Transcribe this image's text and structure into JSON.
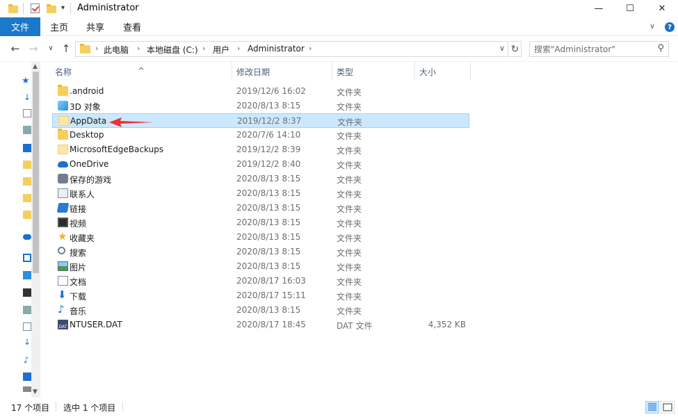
{
  "window": {
    "title": "Administrator",
    "minimize": "—",
    "maximize": "☐",
    "close": "✕"
  },
  "ribbon": {
    "tabs": [
      "文件",
      "主页",
      "共享",
      "查看"
    ],
    "expand": "∨",
    "help": "?"
  },
  "address": {
    "crumbs": [
      "此电脑",
      "本地磁盘 (C:)",
      "用户",
      "Administrator"
    ],
    "separator": "›"
  },
  "search": {
    "placeholder": "搜索\"Administrator\""
  },
  "columns": {
    "name": "名称",
    "date": "修改日期",
    "type": "类型",
    "size": "大小"
  },
  "files": [
    {
      "name": ".android",
      "date": "2019/12/6 16:02",
      "type": "文件夹",
      "size": "",
      "icon": "folder-icon"
    },
    {
      "name": "3D 对象",
      "date": "2020/8/13 8:15",
      "type": "文件夹",
      "size": "",
      "icon": "3d-objects-icon"
    },
    {
      "name": "AppData",
      "date": "2019/12/2 8:37",
      "type": "文件夹",
      "size": "",
      "icon": "hidden-folder-icon",
      "selected": true
    },
    {
      "name": "Desktop",
      "date": "2020/7/6 14:10",
      "type": "文件夹",
      "size": "",
      "icon": "folder-icon"
    },
    {
      "name": "MicrosoftEdgeBackups",
      "date": "2019/12/2 8:39",
      "type": "文件夹",
      "size": "",
      "icon": "hidden-folder-icon"
    },
    {
      "name": "OneDrive",
      "date": "2019/12/2 8:40",
      "type": "文件夹",
      "size": "",
      "icon": "onedrive-icon"
    },
    {
      "name": "保存的游戏",
      "date": "2020/8/13 8:15",
      "type": "文件夹",
      "size": "",
      "icon": "saved-games-icon"
    },
    {
      "name": "联系人",
      "date": "2020/8/13 8:15",
      "type": "文件夹",
      "size": "",
      "icon": "contacts-icon"
    },
    {
      "name": "链接",
      "date": "2020/8/13 8:15",
      "type": "文件夹",
      "size": "",
      "icon": "links-icon"
    },
    {
      "name": "视频",
      "date": "2020/8/13 8:15",
      "type": "文件夹",
      "size": "",
      "icon": "videos-icon"
    },
    {
      "name": "收藏夹",
      "date": "2020/8/13 8:15",
      "type": "文件夹",
      "size": "",
      "icon": "favorites-icon"
    },
    {
      "name": "搜索",
      "date": "2020/8/13 8:15",
      "type": "文件夹",
      "size": "",
      "icon": "searches-icon"
    },
    {
      "name": "图片",
      "date": "2020/8/13 8:15",
      "type": "文件夹",
      "size": "",
      "icon": "pictures-icon"
    },
    {
      "name": "文档",
      "date": "2020/8/17 16:03",
      "type": "文件夹",
      "size": "",
      "icon": "documents-icon"
    },
    {
      "name": "下载",
      "date": "2020/8/17 15:11",
      "type": "文件夹",
      "size": "",
      "icon": "downloads-icon"
    },
    {
      "name": "音乐",
      "date": "2020/8/13 8:15",
      "type": "文件夹",
      "size": "",
      "icon": "music-icon"
    },
    {
      "name": "NTUSER.DAT",
      "date": "2020/8/17 18:45",
      "type": "DAT 文件",
      "size": "4,352 KB",
      "icon": "dat-file-icon"
    }
  ],
  "status": {
    "item_count": "17 个项目",
    "selected": "选中 1 个项目"
  },
  "colors": {
    "file_tab": "#1979ca",
    "selection_bg": "#cce8ff",
    "selection_border": "#99d1ff",
    "annotation_arrow": "#e8332b"
  }
}
